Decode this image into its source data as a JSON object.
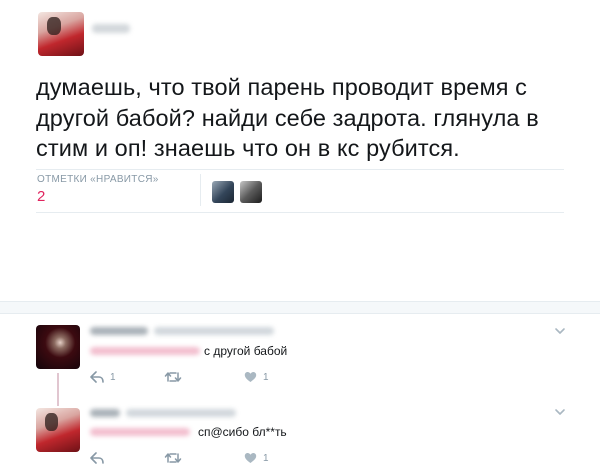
{
  "tweet": {
    "text": "думаешь, что твой парень проводит время с другой бабой? найди себе задрота. глянула в стим и оп! знаешь что он в кс рубится.",
    "likes_label": "ОТМЕТКИ «НРАВИТСЯ»",
    "likes_count": "2"
  },
  "replies": [
    {
      "text": "с другой бабой",
      "reply_count": "1",
      "retweet_count": "",
      "like_count": "1"
    },
    {
      "text": "сп@сибо бл**ть",
      "reply_count": "",
      "retweet_count": "",
      "like_count": "1"
    }
  ],
  "colors": {
    "likes_accent": "#e0245e",
    "muted": "#8899a6",
    "divider": "#e6ecf0"
  },
  "icons": {
    "reply": "reply-icon",
    "retweet": "retweet-icon",
    "like": "heart-icon",
    "more": "chevron-down-icon"
  }
}
